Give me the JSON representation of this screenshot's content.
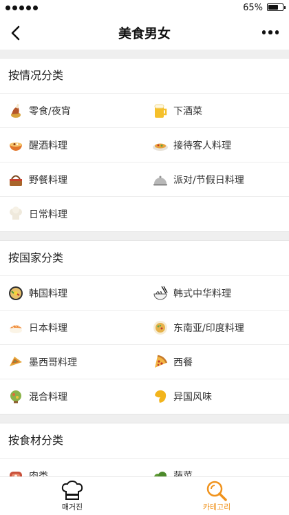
{
  "status_bar": {
    "battery_text": "65%",
    "battery_level": 0.65
  },
  "header": {
    "title": "美食男女"
  },
  "sections": [
    {
      "title": "按情况分类",
      "items": [
        {
          "label": "零食/夜宵",
          "icon": "chicken-leg-icon"
        },
        {
          "label": "下酒菜",
          "icon": "beer-mug-icon"
        },
        {
          "label": "醒酒料理",
          "icon": "noodle-bowl-icon"
        },
        {
          "label": "接待客人料理",
          "icon": "dish-platter-icon"
        },
        {
          "label": "野餐料理",
          "icon": "picnic-basket-icon"
        },
        {
          "label": "派对/节假日料理",
          "icon": "cloche-icon"
        },
        {
          "label": "日常料理",
          "icon": "chef-hat-icon"
        }
      ]
    },
    {
      "title": "按国家分类",
      "items": [
        {
          "label": "韩国料理",
          "icon": "bibimbap-icon"
        },
        {
          "label": "韩式中华料理",
          "icon": "noodles-chopsticks-icon"
        },
        {
          "label": "日本料理",
          "icon": "sushi-icon"
        },
        {
          "label": "东南亚/印度料理",
          "icon": "curry-plate-icon"
        },
        {
          "label": "墨西哥料理",
          "icon": "taco-icon"
        },
        {
          "label": "西餐",
          "icon": "pizza-icon"
        },
        {
          "label": "混合料理",
          "icon": "salad-icon"
        },
        {
          "label": "异国风味",
          "icon": "exotic-fruit-icon"
        }
      ]
    },
    {
      "title": "按食材分类",
      "items": [
        {
          "label": "肉类",
          "icon": "meat-icon"
        },
        {
          "label": "蔬菜",
          "icon": "vegetable-icon"
        }
      ]
    }
  ],
  "tabs": [
    {
      "label": "매거진",
      "icon": "chef-hat-icon",
      "active": false
    },
    {
      "label": "카테고리",
      "icon": "magnifier-icon",
      "active": true
    }
  ],
  "colors": {
    "accent": "#f0931d",
    "background": "#efefef"
  }
}
